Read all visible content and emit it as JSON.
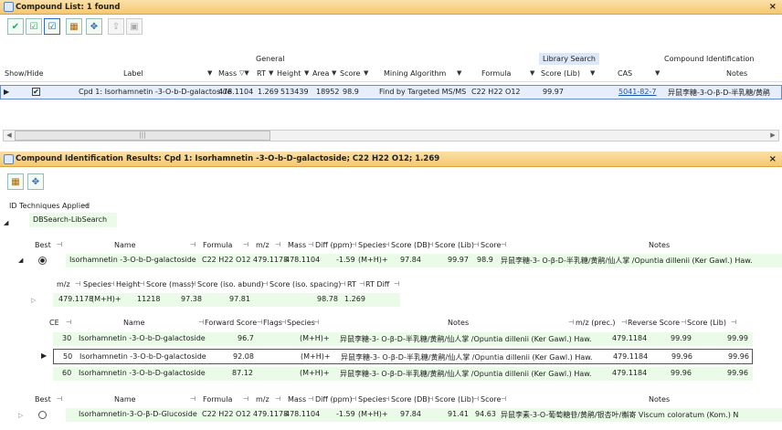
{
  "top_pane": {
    "title": "Compound List: 1 found",
    "close": "×",
    "toolbar": [
      {
        "icon": "check-icon"
      },
      {
        "icon": "check-list-icon"
      },
      {
        "icon": "check-list-bold-icon"
      },
      {
        "icon": "select-columns-icon"
      },
      {
        "icon": "sort-tree-icon"
      },
      {
        "icon": "export-icon"
      },
      {
        "icon": "lock-icon"
      }
    ],
    "groups": {
      "general": "General",
      "library": "Library Search",
      "compound_id": "Compound Identification"
    },
    "headers": {
      "show_hide": "Show/Hide",
      "label": "Label",
      "mass": "Mass",
      "rt": "RT",
      "height": "Height",
      "area": "Area",
      "score": "Score",
      "mining": "Mining Algorithm",
      "formula": "Formula",
      "score_lib": "Score (Lib)",
      "cas": "CAS",
      "notes": "Notes"
    },
    "row": {
      "label": "Cpd 1: Isorhamnetin -3-O-b-D-galactoside",
      "mass": "478.1104",
      "rt": "1.269",
      "height": "513439",
      "area": "18952",
      "score": "98.9",
      "mining": "Find by Targeted MS/MS",
      "formula": "C22 H22 O12",
      "score_lib": "99.97",
      "cas": "5041-82-7",
      "notes": "异鼠李糖-3-O-β-D-半乳糖/黄鹃"
    },
    "scroll_thumb": "|||"
  },
  "bottom_pane": {
    "title": "Compound Identification Results: Cpd 1: Isorhamnetin -3-O-b-D-galactoside; C22 H22 O12; 1.269",
    "close": "×",
    "techniques_label": "ID Techniques Applied",
    "technique": "DBSearch-LibSearch",
    "best_headers": {
      "best": "Best",
      "name": "Name",
      "formula": "Formula",
      "mz": "m/z",
      "mass": "Mass",
      "diff": "Diff (ppm)",
      "species": "Species",
      "score_db": "Score (DB)",
      "score_lib": "Score (Lib)",
      "score": "Score",
      "notes": "Notes"
    },
    "best_row1": {
      "name": "Isorhamnetin -3-O-b-D-galactoside",
      "formula": "C22 H22 O12",
      "mz": "479.1178",
      "mass": "478.1104",
      "diff": "-1.59",
      "species": "(M+H)+",
      "score_db": "97.84",
      "score_lib": "99.97",
      "score": "98.9",
      "notes": "异鼠李糖-3- O-β-D-半乳糖/黄鹃/仙人掌 /Opuntia dillenii (Ker Gawl.) Haw."
    },
    "sub_headers": {
      "mz": "m/z",
      "species": "Species",
      "height": "Height",
      "score_mass": "Score (mass)",
      "score_iso_abund": "Score (iso. abund)",
      "score_iso_spacing": "Score (iso. spacing)",
      "rt": "RT",
      "rt_diff": "RT Diff"
    },
    "sub_row": {
      "mz": "479.1178",
      "species": "(M+H)+",
      "height": "11218",
      "score_mass": "97.38",
      "score_iso_abund": "97.81",
      "score_iso_spacing": "98.78",
      "rt": "1.269"
    },
    "ce_headers": {
      "ce": "CE",
      "name": "Name",
      "forward": "Forward Score",
      "flags": "Flags",
      "species": "Species",
      "notes": "Notes",
      "mz_prec": "m/z (prec.)",
      "reverse": "Reverse Score",
      "score_lib": "Score (Lib)"
    },
    "ce_rows": [
      {
        "ce": "30",
        "name": "Isorhamnetin -3-O-b-D-galactoside",
        "forward": "96.7",
        "species": "(M+H)+",
        "notes": "异鼠李糖-3- O-β-D-半乳糖/黄鹃/仙人掌 /Opuntia dillenii (Ker Gawl.) Haw.",
        "mz": "479.1184",
        "reverse": "99.99",
        "lib": "99.99"
      },
      {
        "ce": "50",
        "name": "Isorhamnetin -3-O-b-D-galactoside",
        "forward": "92.08",
        "species": "(M+H)+",
        "notes": "异鼠李糖-3- O-β-D-半乳糖/黄鹃/仙人掌 /Opuntia dillenii (Ker Gawl.) Haw.",
        "mz": "479.1184",
        "reverse": "99.96",
        "lib": "99.96"
      },
      {
        "ce": "60",
        "name": "Isorhamnetin -3-O-b-D-galactoside",
        "forward": "87.12",
        "species": "(M+H)+",
        "notes": "异鼠李糖-3- O-β-D-半乳糖/黄鹃/仙人掌 /Opuntia dillenii (Ker Gawl.) Haw.",
        "mz": "479.1184",
        "reverse": "99.96",
        "lib": "99.96"
      }
    ],
    "best_row2": {
      "name": "Isorhamnetin-3-O-β-D-Glucoside",
      "formula": "C22 H22 O12",
      "mz": "479.1178",
      "mass": "478.1104",
      "diff": "-1.59",
      "species": "(M+H)+",
      "score_db": "97.84",
      "score_lib": "91.41",
      "score": "94.63",
      "notes": "异鼠李素-3-O-葡萄糖苷/黄鹃/银杏叶/槲寄 Viscum coloratum (Kom.) N"
    }
  },
  "colors": {
    "header": "#f5c870",
    "selection": "#e6eefb",
    "green": "#eafbe8",
    "accent": "#1a55b8"
  }
}
